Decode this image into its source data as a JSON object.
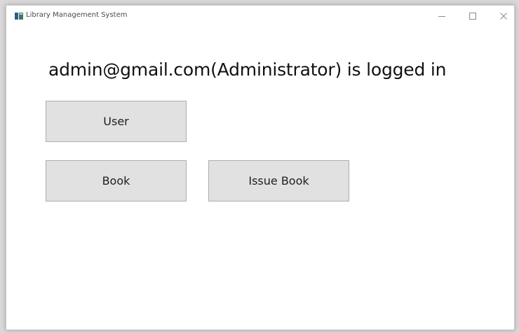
{
  "window": {
    "title": "Library Management System",
    "icon": "library-app-icon",
    "controls": {
      "minimize": "minimize-icon",
      "maximize": "maximize-icon",
      "close": "close-icon"
    }
  },
  "main": {
    "login_status": "admin@gmail.com(Administrator) is logged in",
    "buttons": {
      "user": "User",
      "book": "Book",
      "issue_book": "Issue Book"
    }
  },
  "colors": {
    "button_bg": "#e1e1e1",
    "button_border": "#adadad",
    "window_bg": "#ffffff"
  }
}
